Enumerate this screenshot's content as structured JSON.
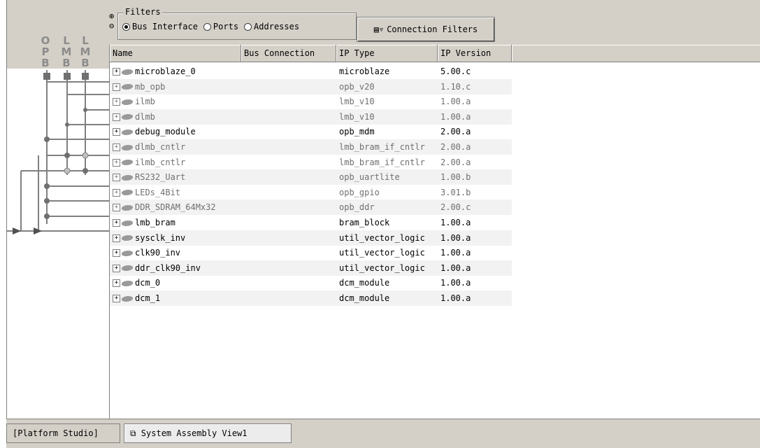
{
  "bus_panel": {
    "columns": [
      {
        "letters": [
          "O",
          "P",
          "B"
        ]
      },
      {
        "letters": [
          "L",
          "M",
          "B"
        ]
      },
      {
        "letters": [
          "L",
          "M",
          "B"
        ]
      }
    ]
  },
  "toolbar": {
    "filters_legend": "Filters",
    "radios": [
      {
        "label": "Bus Interface",
        "checked": true
      },
      {
        "label": "Ports",
        "checked": false
      },
      {
        "label": "Addresses",
        "checked": false
      }
    ],
    "connection_filters_label": "Connection Filters"
  },
  "table": {
    "headers": [
      "Name",
      "Bus Connection",
      "IP Type",
      "IP Version"
    ],
    "rows": [
      {
        "name": "microblaze_0",
        "bus": "",
        "type": "microblaze",
        "version": "5.00.c",
        "muted": false
      },
      {
        "name": "mb_opb",
        "bus": "",
        "type": "opb_v20",
        "version": "1.10.c",
        "muted": true
      },
      {
        "name": "ilmb",
        "bus": "",
        "type": "lmb_v10",
        "version": "1.00.a",
        "muted": true
      },
      {
        "name": "dlmb",
        "bus": "",
        "type": "lmb_v10",
        "version": "1.00.a",
        "muted": true
      },
      {
        "name": "debug_module",
        "bus": "",
        "type": "opb_mdm",
        "version": "2.00.a",
        "muted": false
      },
      {
        "name": "dlmb_cntlr",
        "bus": "",
        "type": "lmb_bram_if_cntlr",
        "version": "2.00.a",
        "muted": true
      },
      {
        "name": "ilmb_cntlr",
        "bus": "",
        "type": "lmb_bram_if_cntlr",
        "version": "2.00.a",
        "muted": true
      },
      {
        "name": "RS232_Uart",
        "bus": "",
        "type": "opb_uartlite",
        "version": "1.00.b",
        "muted": true
      },
      {
        "name": "LEDs_4Bit",
        "bus": "",
        "type": "opb_gpio",
        "version": "3.01.b",
        "muted": true
      },
      {
        "name": "DDR_SDRAM_64Mx32",
        "bus": "",
        "type": "opb_ddr",
        "version": "2.00.c",
        "muted": true
      },
      {
        "name": "lmb_bram",
        "bus": "",
        "type": "bram_block",
        "version": "1.00.a",
        "muted": false
      },
      {
        "name": "sysclk_inv",
        "bus": "",
        "type": "util_vector_logic",
        "version": "1.00.a",
        "muted": false
      },
      {
        "name": "clk90_inv",
        "bus": "",
        "type": "util_vector_logic",
        "version": "1.00.a",
        "muted": false
      },
      {
        "name": "ddr_clk90_inv",
        "bus": "",
        "type": "util_vector_logic",
        "version": "1.00.a",
        "muted": false
      },
      {
        "name": "dcm_0",
        "bus": "",
        "type": "dcm_module",
        "version": "1.00.a",
        "muted": false
      },
      {
        "name": "dcm_1",
        "bus": "",
        "type": "dcm_module",
        "version": "1.00.a",
        "muted": false
      }
    ]
  },
  "status": {
    "left_tab": "[Platform Studio]",
    "view_tab": "System Assembly View1"
  }
}
